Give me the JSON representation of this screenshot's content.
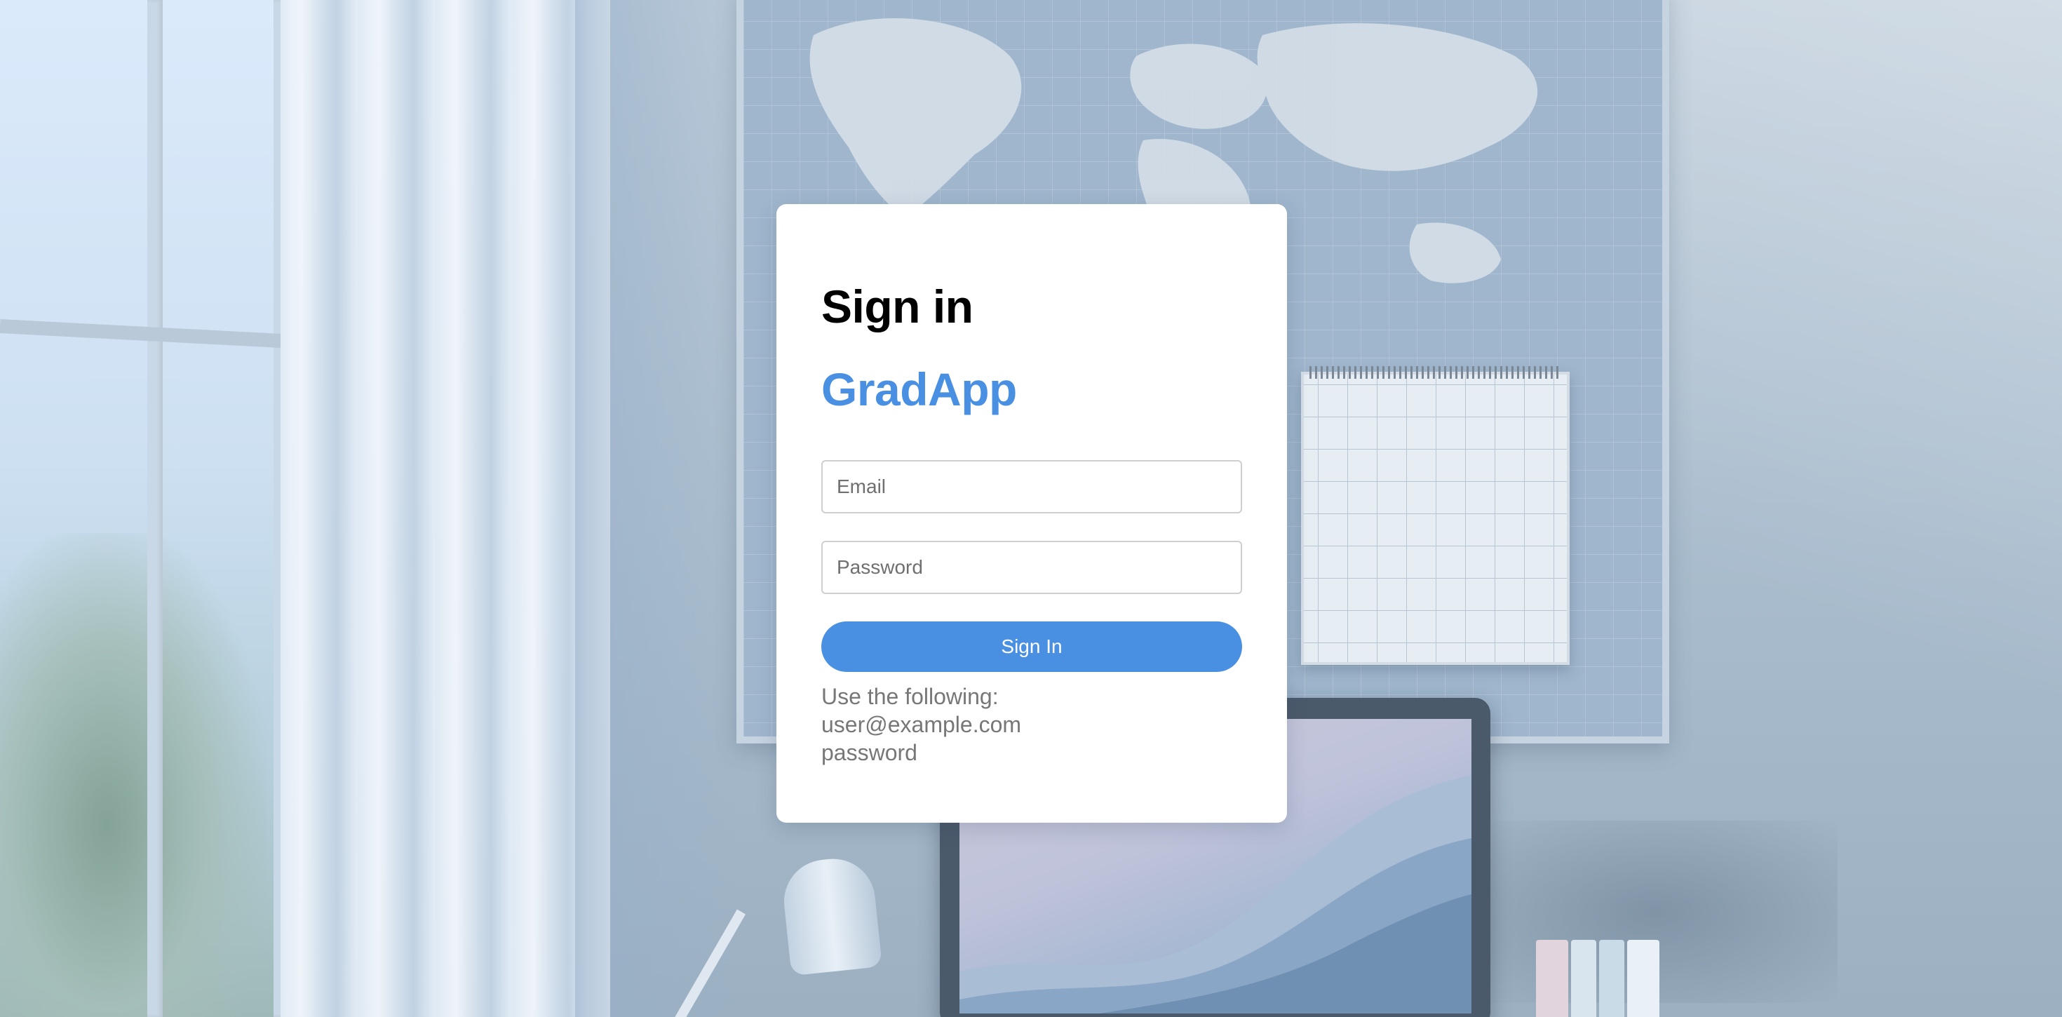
{
  "page": {
    "title": "Sign in",
    "brand": "GradApp"
  },
  "form": {
    "email_placeholder": "Email",
    "email_value": "",
    "password_placeholder": "Password",
    "password_value": "",
    "submit_label": "Sign In"
  },
  "hint": {
    "intro": "Use the following:",
    "email": "user@example.com",
    "password": "password"
  },
  "colors": {
    "accent": "#4a90e2",
    "card_background": "#ffffff",
    "hint_text": "#777777"
  },
  "background": {
    "icon": "home-office-background-image"
  }
}
